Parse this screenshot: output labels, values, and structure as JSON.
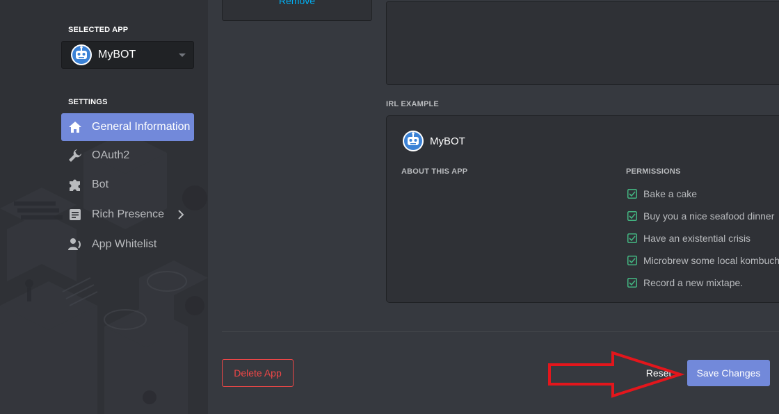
{
  "sidebar": {
    "selected_app_label": "SELECTED APP",
    "selected_app_name": "MyBOT",
    "settings_label": "SETTINGS",
    "items": [
      {
        "label": "General Information",
        "icon": "home-icon",
        "active": true
      },
      {
        "label": "OAuth2",
        "icon": "wrench-icon"
      },
      {
        "label": "Bot",
        "icon": "puzzle-icon"
      },
      {
        "label": "Rich Presence",
        "icon": "document-icon"
      },
      {
        "label": "App Whitelist",
        "icon": "person-phone-icon"
      }
    ]
  },
  "main": {
    "remove_link": "Remove",
    "irl_example_label": "IRL EXAMPLE",
    "irl_app_name": "MyBOT",
    "about_label": "ABOUT THIS APP",
    "permissions_label": "PERMISSIONS",
    "permissions": [
      "Bake a cake",
      "Buy you a nice seafood dinner",
      "Have an existential crisis",
      "Microbrew some local kombucha",
      "Record a new mixtape."
    ]
  },
  "footer": {
    "delete_label": "Delete App",
    "reset_label": "Reset",
    "save_label": "Save Changes"
  },
  "colors": {
    "accent": "#7289da",
    "danger": "#f04747",
    "check": "#43b581",
    "link": "#00b0f4",
    "annotation_arrow": "#e3161c"
  }
}
